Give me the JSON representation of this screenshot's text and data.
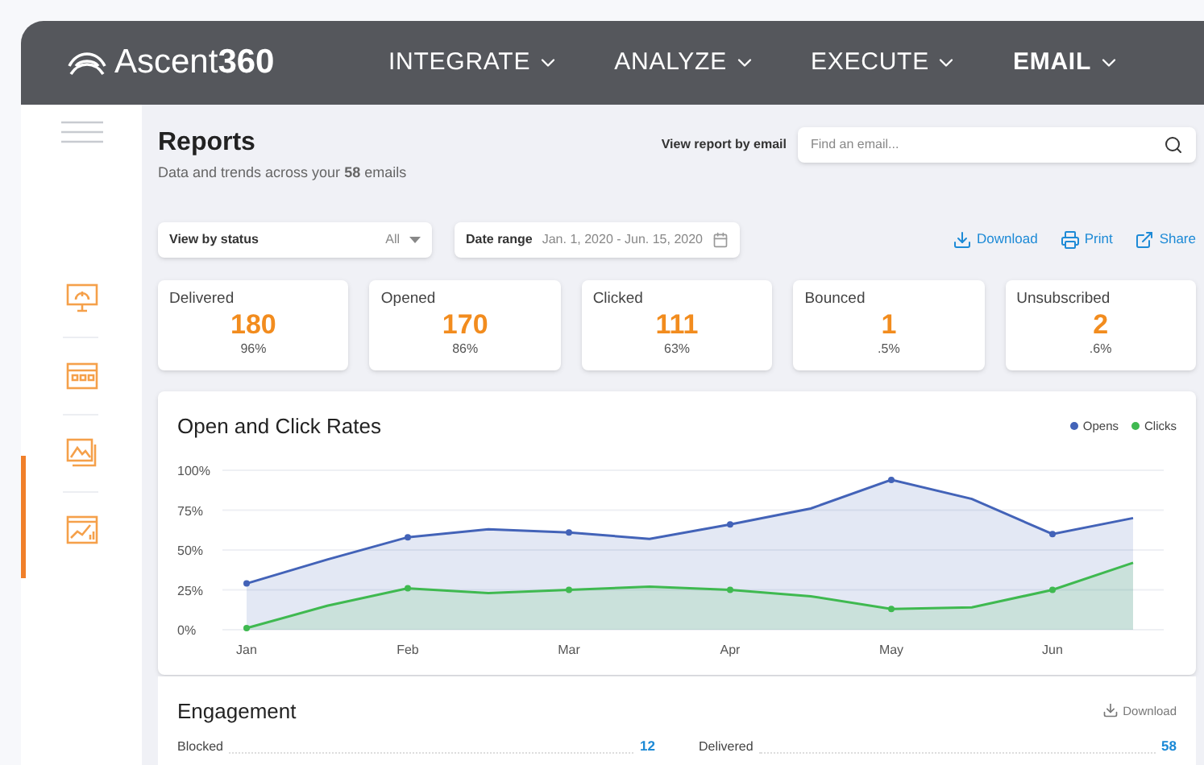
{
  "header": {
    "logo": {
      "name": "Ascent",
      "suffix": "360"
    },
    "nav": [
      {
        "label": "INTEGRATE",
        "selected": false
      },
      {
        "label": "ANALYZE",
        "selected": false
      },
      {
        "label": "EXECUTE",
        "selected": false
      },
      {
        "label": "EMAIL",
        "selected": true
      }
    ]
  },
  "sidebar": {
    "items": [
      {
        "kind": "monitor",
        "selected": false
      },
      {
        "kind": "calendar",
        "selected": false
      },
      {
        "kind": "image",
        "selected": false
      },
      {
        "kind": "chart",
        "selected": true
      }
    ]
  },
  "page": {
    "title": "Reports",
    "subtitle": "Data and trends across your **58** emails",
    "search_label": "View report by email",
    "search": {
      "placeholder": "Find an email..."
    }
  },
  "filters": {
    "status": {
      "label": "View by status",
      "value": "All"
    },
    "date": {
      "label": "Date range",
      "value": "Jan. 1, 2020 - Jun. 15, 2020"
    }
  },
  "actions": [
    {
      "kind": "download",
      "label": "Download"
    },
    {
      "kind": "print",
      "label": "Print"
    },
    {
      "kind": "share",
      "label": "Share"
    }
  ],
  "stats": [
    {
      "label": "Delivered",
      "value": "180",
      "percent": "96%"
    },
    {
      "label": "Opened",
      "value": "170",
      "percent": "86%"
    },
    {
      "label": "Clicked",
      "value": "111",
      "percent": "63%"
    },
    {
      "label": "Bounced",
      "value": "1",
      "percent": ".5%"
    },
    {
      "label": "Unsubscribed",
      "value": "2",
      "percent": ".6%"
    }
  ],
  "rates": {
    "title": "Open and Click Rates",
    "chart_data": {
      "type": "area",
      "categories": [
        "Jan",
        null,
        "Feb",
        null,
        "Mar",
        null,
        "Apr",
        null,
        "May",
        null,
        "Jun",
        null
      ],
      "series": [
        {
          "name": "Opens",
          "color": "#4363b8",
          "values": [
            29,
            44,
            58,
            63,
            61,
            57,
            66,
            76,
            94,
            82,
            60,
            70
          ]
        },
        {
          "name": "Clicks",
          "color": "#3fb950",
          "values": [
            1,
            15,
            26,
            23,
            25,
            27,
            25,
            21,
            13,
            14,
            25,
            42
          ]
        }
      ],
      "yticks": [
        {
          "value": 0,
          "label": "0%"
        },
        {
          "value": 25,
          "label": "25%"
        },
        {
          "value": 50,
          "label": "50%"
        },
        {
          "value": 75,
          "label": "75%"
        },
        {
          "value": 100,
          "label": "100%"
        }
      ],
      "grid": true,
      "ylim": [
        0,
        100
      ]
    }
  },
  "engagement": {
    "title": "Engagement",
    "download": "Download",
    "rows": [
      {
        "label": "Blocked",
        "value": "12"
      },
      {
        "label": "Delivered",
        "value": "58"
      }
    ]
  }
}
